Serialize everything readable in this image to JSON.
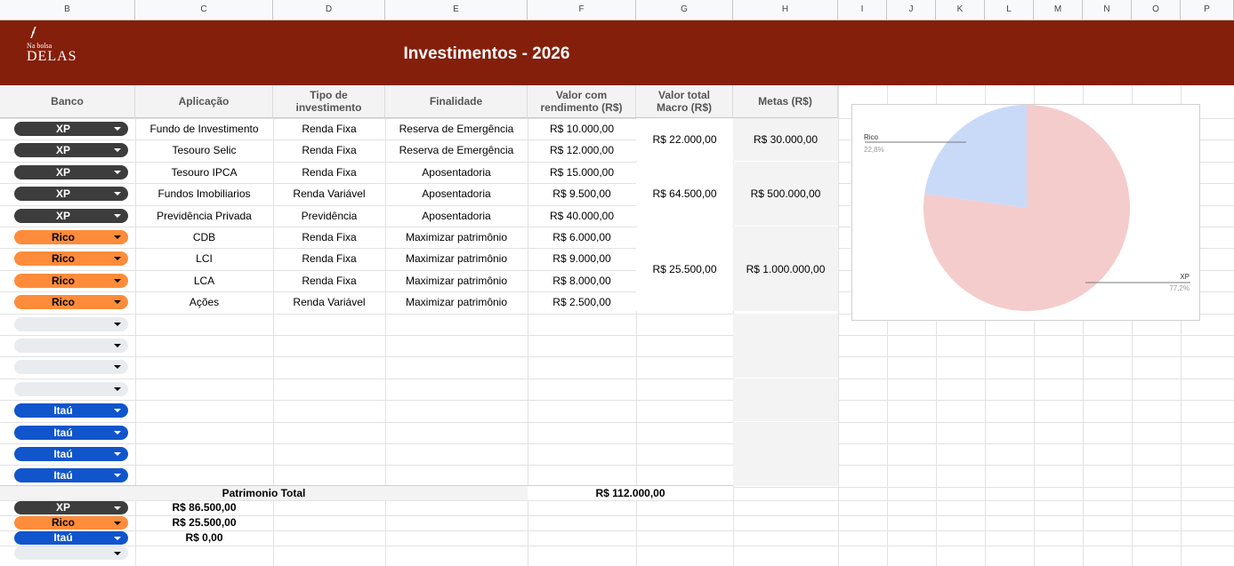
{
  "columns": [
    "B",
    "C",
    "D",
    "E",
    "F",
    "G",
    "H",
    "I",
    "J",
    "K",
    "L",
    "M",
    "N",
    "O",
    "P"
  ],
  "banner": {
    "title": "Investimentos - 2026",
    "logo_small": "Na bolsa",
    "logo_big": "DELAS",
    "color": "#841f0b"
  },
  "headers": {
    "banco": "Banco",
    "aplicacao": "Aplicação",
    "tipo": "Tipo de investimento",
    "finalidade": "Finalidade",
    "valor": "Valor com rendimento (R$)",
    "macro": "Valor total Macro (R$)",
    "metas": "Metas (R$)"
  },
  "rows": [
    {
      "banco": "XP",
      "aplicacao": "Fundo de Investimento",
      "tipo": "Renda Fixa",
      "finalidade": "Reserva de Emergência",
      "valor": "R$ 10.000,00"
    },
    {
      "banco": "XP",
      "aplicacao": "Tesouro Selic",
      "tipo": "Renda Fixa",
      "finalidade": "Reserva de Emergência",
      "valor": "R$ 12.000,00"
    },
    {
      "banco": "XP",
      "aplicacao": "Tesouro IPCA",
      "tipo": "Renda Fixa",
      "finalidade": "Aposentadoria",
      "valor": "R$ 15.000,00"
    },
    {
      "banco": "XP",
      "aplicacao": "Fundos Imobiliarios",
      "tipo": "Renda Variável",
      "finalidade": "Aposentadoria",
      "valor": "R$ 9.500,00"
    },
    {
      "banco": "XP",
      "aplicacao": "Previdência Privada",
      "tipo": "Previdência",
      "finalidade": "Aposentadoria",
      "valor": "R$ 40.000,00"
    },
    {
      "banco": "Rico",
      "aplicacao": "CDB",
      "tipo": "Renda Fixa",
      "finalidade": "Maximizar patrimônio",
      "valor": "R$ 6.000,00"
    },
    {
      "banco": "Rico",
      "aplicacao": "LCI",
      "tipo": "Renda Fixa",
      "finalidade": "Maximizar patrimônio",
      "valor": "R$ 9.000,00"
    },
    {
      "banco": "Rico",
      "aplicacao": "LCA",
      "tipo": "Renda Fixa",
      "finalidade": "Maximizar patrimônio",
      "valor": "R$ 8.000,00"
    },
    {
      "banco": "Rico",
      "aplicacao": "Ações",
      "tipo": "Renda Variável",
      "finalidade": "Maximizar patrimônio",
      "valor": "R$ 2.500,00"
    },
    {
      "banco": "",
      "aplicacao": "",
      "tipo": "",
      "finalidade": "",
      "valor": ""
    },
    {
      "banco": "",
      "aplicacao": "",
      "tipo": "",
      "finalidade": "",
      "valor": ""
    },
    {
      "banco": "",
      "aplicacao": "",
      "tipo": "",
      "finalidade": "",
      "valor": ""
    },
    {
      "banco": "",
      "aplicacao": "",
      "tipo": "",
      "finalidade": "",
      "valor": ""
    },
    {
      "banco": "Itaú",
      "aplicacao": "",
      "tipo": "",
      "finalidade": "",
      "valor": ""
    },
    {
      "banco": "Itaú",
      "aplicacao": "",
      "tipo": "",
      "finalidade": "",
      "valor": ""
    },
    {
      "banco": "Itaú",
      "aplicacao": "",
      "tipo": "",
      "finalidade": "",
      "valor": ""
    },
    {
      "banco": "Itaú",
      "aplicacao": "",
      "tipo": "",
      "finalidade": "",
      "valor": ""
    }
  ],
  "macro_groups": [
    {
      "total": "R$ 22.000,00",
      "meta": "R$ 30.000,00"
    },
    {
      "total": "R$ 64.500,00",
      "meta": "R$ 500.000,00"
    },
    {
      "total": "R$ 25.500,00",
      "meta": "R$ 1.000.000,00"
    }
  ],
  "patrimonio": {
    "label": "Patrimonio Total",
    "total": "R$ 112.000,00"
  },
  "summary": [
    {
      "banco": "XP",
      "valor": "R$ 86.500,00"
    },
    {
      "banco": "Rico",
      "valor": "R$ 25.500,00"
    },
    {
      "banco": "Itaú",
      "valor": "R$ 0,00"
    },
    {
      "banco": "",
      "valor": ""
    }
  ],
  "chip_colors": {
    "XP": "#3d3d3d",
    "Rico": "#ff8c3a",
    "Itaú": "#1155cc"
  },
  "chart_data": {
    "type": "pie",
    "slices": [
      {
        "label": "XP",
        "value": 77.2,
        "display": "77,2%",
        "color": "#f4cccc"
      },
      {
        "label": "Rico",
        "value": 22.8,
        "display": "22,8%",
        "color": "#c9daf8"
      }
    ]
  }
}
